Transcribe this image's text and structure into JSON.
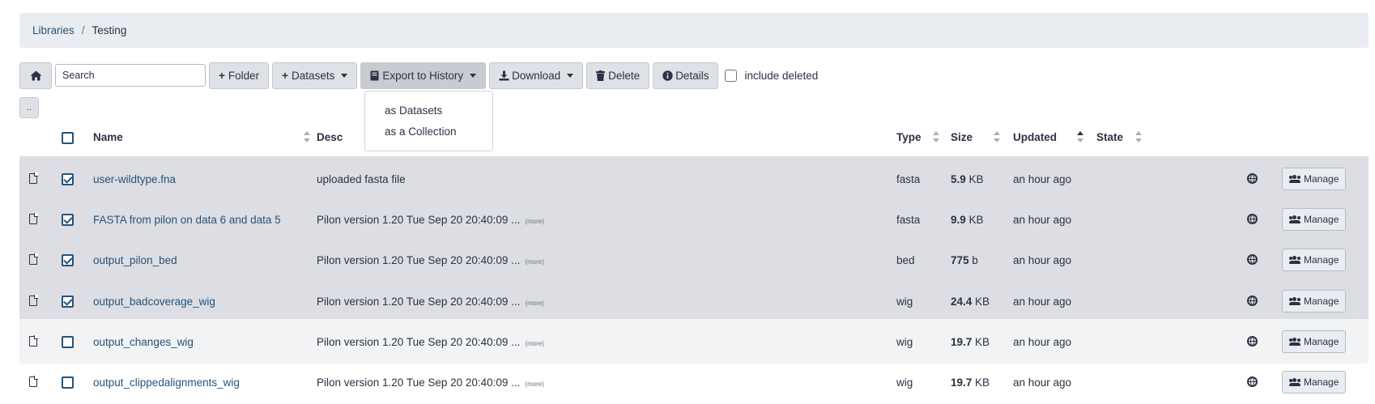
{
  "breadcrumb": {
    "root": "Libraries",
    "separator": "/",
    "current": "Testing"
  },
  "toolbar": {
    "search_placeholder": "Search",
    "folder_label": "Folder",
    "datasets_label": "Datasets",
    "export_label": "Export to History",
    "download_label": "Download",
    "delete_label": "Delete",
    "details_label": "Details",
    "include_deleted_label": "include deleted",
    "parent_label": ".."
  },
  "export_menu": {
    "items": [
      "as Datasets",
      "as a Collection"
    ]
  },
  "table": {
    "columns": {
      "name": "Name",
      "description": "Desc",
      "type": "Type",
      "size": "Size",
      "updated": "Updated",
      "state": "State"
    },
    "sort": {
      "column": "Updated",
      "direction": "ascending"
    },
    "manage_label": "Manage",
    "more_label": "(more)",
    "rows": [
      {
        "name": "user-wildtype.fna",
        "description": "uploaded fasta file",
        "more": "",
        "type": "fasta",
        "size_value": "5.9",
        "size_unit": "KB",
        "updated": "an hour ago",
        "checked": true
      },
      {
        "name": "FASTA from pilon on data 6 and data 5",
        "description": "Pilon version 1.20 Tue Sep 20 20:40:09 ...",
        "more": "(more)",
        "type": "fasta",
        "size_value": "9.9",
        "size_unit": "KB",
        "updated": "an hour ago",
        "checked": true
      },
      {
        "name": "output_pilon_bed",
        "description": "Pilon version 1.20 Tue Sep 20 20:40:09 ...",
        "more": "(more)",
        "type": "bed",
        "size_value": "775",
        "size_unit": "b",
        "updated": "an hour ago",
        "checked": true
      },
      {
        "name": "output_badcoverage_wig",
        "description": "Pilon version 1.20 Tue Sep 20 20:40:09 ...",
        "more": "(more)",
        "type": "wig",
        "size_value": "24.4",
        "size_unit": "KB",
        "updated": "an hour ago",
        "checked": true
      },
      {
        "name": "output_changes_wig",
        "description": "Pilon version 1.20 Tue Sep 20 20:40:09 ...",
        "more": "(more)",
        "type": "wig",
        "size_value": "19.7",
        "size_unit": "KB",
        "updated": "an hour ago",
        "checked": false
      },
      {
        "name": "output_clippedalignments_wig",
        "description": "Pilon version 1.20 Tue Sep 20 20:40:09 ...",
        "more": "(more)",
        "type": "wig",
        "size_value": "19.7",
        "size_unit": "KB",
        "updated": "an hour ago",
        "checked": false
      }
    ]
  },
  "colors": {
    "link": "#25537b",
    "selected_row": "#dcdee3",
    "button": "#dee2e6",
    "breadcrumb_bg": "#e9ecf0"
  },
  "icons": {
    "home": "home-icon",
    "plus": "plus-icon",
    "book": "book-icon",
    "download": "download-icon",
    "trash": "trash-icon",
    "info": "info-circle-icon",
    "file": "file-icon",
    "globe": "globe-icon",
    "users": "users-icon"
  }
}
